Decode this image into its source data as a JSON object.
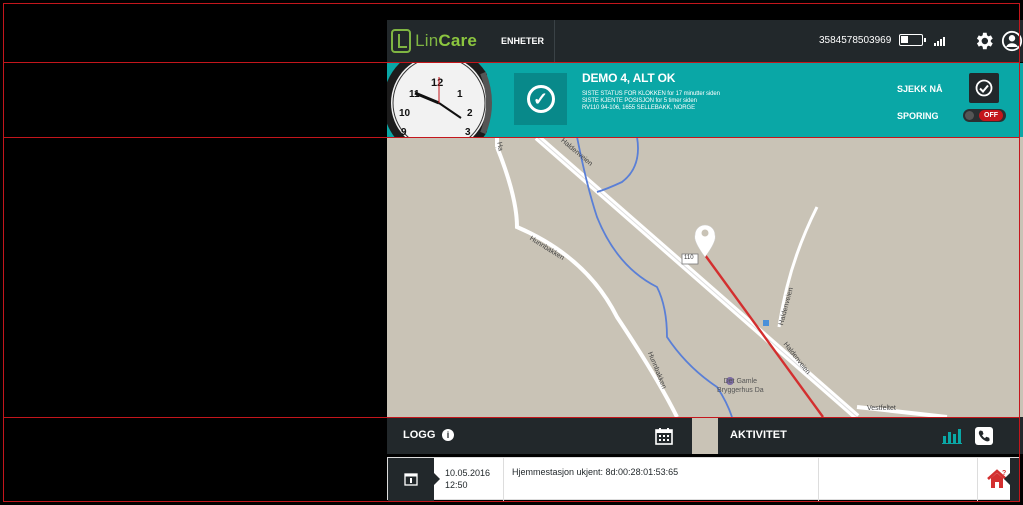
{
  "header": {
    "logo_lin": "Lin",
    "logo_care": "Care",
    "nav_devices": "ENHETER",
    "phone_number": "3584578503969",
    "battery_level": 0.35,
    "icons": [
      "battery-icon",
      "signal-icon",
      "gear-icon",
      "user-icon"
    ]
  },
  "status": {
    "title": "DEMO 4, ALT OK",
    "line1": "SISTE STATUS FOR KLOKKEN for 17 minutter siden",
    "line2": "SISTE KJENTE POSISJON for 5 timer siden",
    "line3": "RV110 94-106, 1655 SELLEBAKK, NORGE",
    "check_now_label": "SJEKK NÅ",
    "tracking_label": "SPORING",
    "tracking_state": "OFF",
    "accent_color": "#0aa7a6"
  },
  "map": {
    "road_labels": [
      "Haldenveien",
      "Hunnbakken",
      "Hunnbakken",
      "Haldenveien",
      "Haldenveien",
      "Vestfeltet",
      "Ha"
    ],
    "route_shield": "110",
    "poi_line1": "Det Gamle",
    "poi_line2": "Bryggerhus Da"
  },
  "log": {
    "title": "LOGG",
    "info": "i"
  },
  "activity": {
    "title": "AKTIVITET"
  },
  "log_entries": [
    {
      "date": "10.05.2016",
      "time": "12:50",
      "message": "Hjemmestasjon ukjent: 8d:00:28:01:53:65"
    }
  ]
}
